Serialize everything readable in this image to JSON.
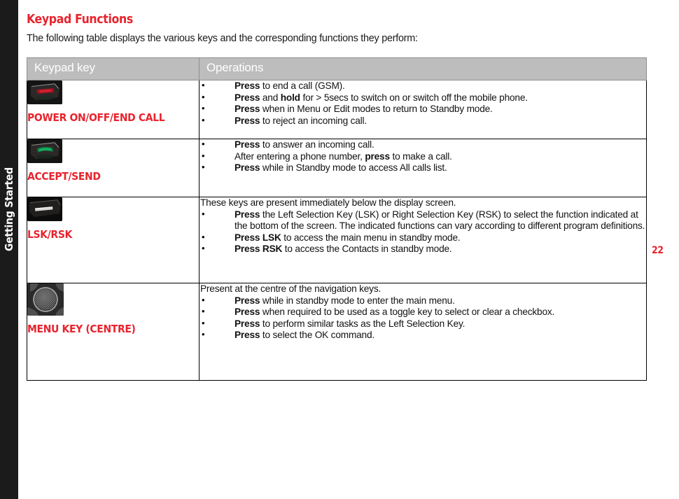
{
  "side_rail": {
    "label": "Getting Started",
    "background": "#1b1b1b",
    "text_color": "#ffffff"
  },
  "page": {
    "title": "Keypad Functions",
    "intro": "The following table displays the various keys and the corresponding functions they perform:",
    "page_number": "22",
    "accent_color": "#e8242e",
    "header_bg": "#bdbdbd"
  },
  "table": {
    "headers": [
      "Keypad key",
      "Operations"
    ],
    "rows": [
      {
        "key_label": "POWER ON/OFF/END CALL",
        "key_icon": "end-call-key-photo",
        "lead": "",
        "bullets": [
          [
            {
              "t": "Press",
              "b": true
            },
            {
              "t": " to end a call (GSM).",
              "b": false
            }
          ],
          [
            {
              "t": "Press",
              "b": true
            },
            {
              "t": " and ",
              "b": false
            },
            {
              "t": "hold",
              "b": true
            },
            {
              "t": " for > 5secs to switch on or switch off the mobile phone.",
              "b": false
            }
          ],
          [
            {
              "t": "Press",
              "b": true
            },
            {
              "t": " when in Menu or Edit modes to return to  Standby mode.",
              "b": false
            }
          ],
          [
            {
              "t": "Press",
              "b": true
            },
            {
              "t": " to reject an incoming call.",
              "b": false
            }
          ]
        ]
      },
      {
        "key_label": "ACCEPT/SEND",
        "key_icon": "accept-send-key-photo",
        "lead": "",
        "bullets": [
          [
            {
              "t": "Press",
              "b": true
            },
            {
              "t": " to answer an incoming call.",
              "b": false
            }
          ],
          [
            {
              "t": "After entering a phone number, ",
              "b": false
            },
            {
              "t": "press",
              "b": true
            },
            {
              "t": " to make a call.",
              "b": false
            }
          ],
          [
            {
              "t": "Press",
              "b": true
            },
            {
              "t": " while in Standby mode to access All calls list.",
              "b": false
            }
          ]
        ]
      },
      {
        "key_label": "LSK/RSK",
        "key_icon": "selection-key-photo",
        "lead": "These keys are present immediately below the display screen.",
        "bullets": [
          [
            {
              "t": "Press",
              "b": true
            },
            {
              "t": " the Left Selection Key (LSK) or Right Selection Key (RSK) to select the function indicated at the bottom of the screen. The indicated functions can vary according to different program definitions.",
              "b": false
            }
          ],
          [
            {
              "t": "Press LSK",
              "b": true
            },
            {
              "t": " to access the main menu in standby mode.",
              "b": false
            }
          ],
          [
            {
              "t": "Press RSK",
              "b": true
            },
            {
              "t": " to access the Contacts in standby mode.",
              "b": false
            }
          ]
        ]
      },
      {
        "key_label": "MENU KEY (CENTRE)",
        "key_icon": "menu-key-photo",
        "lead": "Present at the centre of the navigation keys.",
        "bullets": [
          [
            {
              "t": "Press",
              "b": true
            },
            {
              "t": " while in standby mode to enter the main menu.",
              "b": false
            }
          ],
          [
            {
              "t": "Press",
              "b": true
            },
            {
              "t": " when required to be used as a toggle key to select or clear a checkbox.",
              "b": false
            }
          ],
          [
            {
              "t": "Press",
              "b": true
            },
            {
              "t": " to perform similar tasks as the Left Selection Key.",
              "b": false
            }
          ],
          [
            {
              "t": "Press",
              "b": true
            },
            {
              "t": " to select the OK command.",
              "b": false
            }
          ]
        ]
      }
    ]
  }
}
